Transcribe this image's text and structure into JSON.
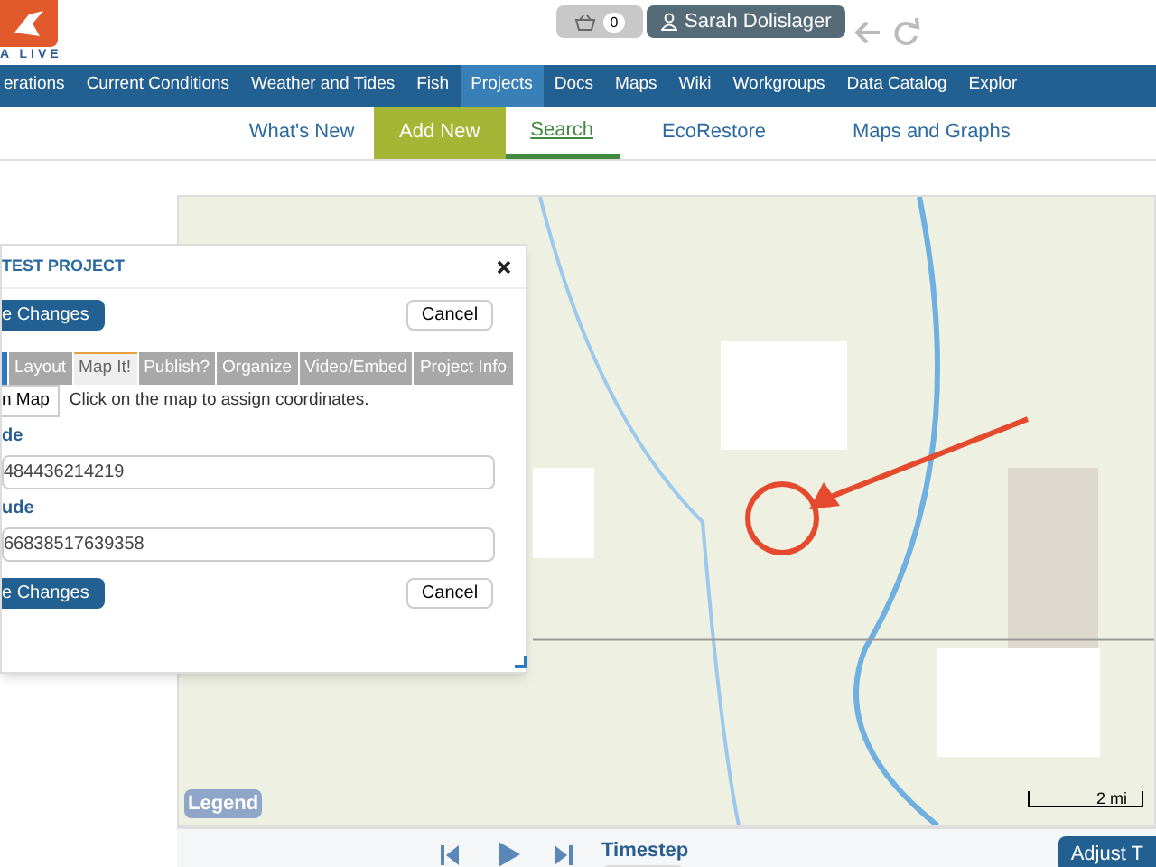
{
  "logo": {
    "text": "A LIVE"
  },
  "cart": {
    "count": "0"
  },
  "user": {
    "name": "Sarah Dolislager"
  },
  "nav": [
    {
      "label": "erations",
      "selected": false
    },
    {
      "label": "Current Conditions",
      "selected": false
    },
    {
      "label": "Weather and Tides",
      "selected": false
    },
    {
      "label": "Fish",
      "selected": false
    },
    {
      "label": "Projects",
      "selected": true
    },
    {
      "label": "Docs",
      "selected": false
    },
    {
      "label": "Maps",
      "selected": false
    },
    {
      "label": "Wiki",
      "selected": false
    },
    {
      "label": "Workgroups",
      "selected": false
    },
    {
      "label": "Data Catalog",
      "selected": false
    },
    {
      "label": "Explor",
      "selected": false
    }
  ],
  "subnav": [
    {
      "label": "What's New",
      "kind": "link",
      "selected": false
    },
    {
      "label": "Add New",
      "kind": "highlight",
      "selected": false
    },
    {
      "label": "Search",
      "kind": "link",
      "selected": true
    },
    {
      "label": "EcoRestore",
      "kind": "link",
      "selected": false
    },
    {
      "label": "Maps and Graphs",
      "kind": "link",
      "selected": false
    }
  ],
  "dialog": {
    "title": "TEST PROJECT",
    "save": "e Changes",
    "cancel": "Cancel",
    "tabs": [
      {
        "label": "Layout",
        "selected": false
      },
      {
        "label": "Map It!",
        "selected": true
      },
      {
        "label": "Publish?",
        "selected": false
      },
      {
        "label": "Organize",
        "selected": false
      },
      {
        "label": "Video/Embed",
        "selected": false
      },
      {
        "label": "Project Info",
        "selected": false
      }
    ],
    "map_button": "n Map",
    "hint": "Click on the map to assign coordinates.",
    "fields": [
      {
        "label": "de",
        "value": "484436214219"
      },
      {
        "label": "ude",
        "value": "66838517639358"
      }
    ],
    "save_bottom": "e Changes",
    "cancel_bottom": "Cancel"
  },
  "map": {
    "legend": "Legend",
    "scale": "2 mi"
  },
  "player": {
    "timestep": "Timestep",
    "adjust": "Adjust T"
  }
}
